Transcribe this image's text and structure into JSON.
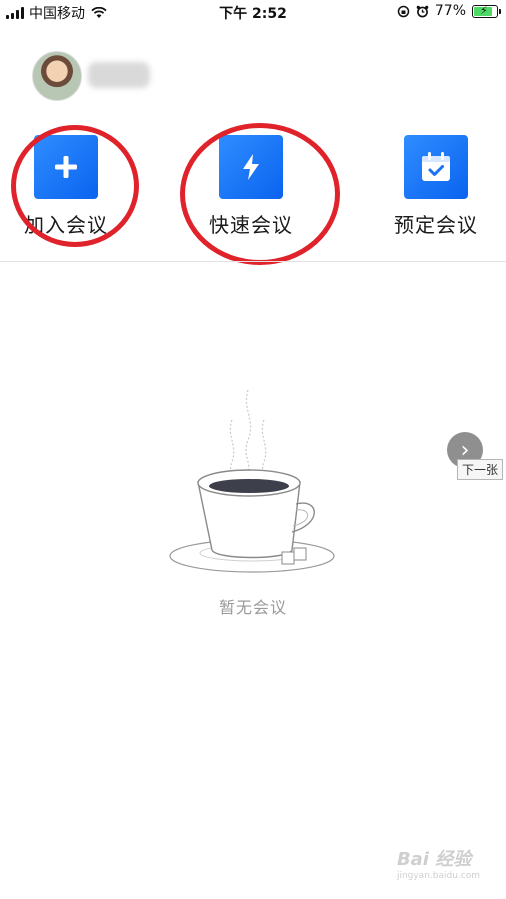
{
  "status_bar": {
    "carrier": "中国移动",
    "time": "下午 2:52",
    "battery_percent": "77%",
    "battery_level": 0.77,
    "icons": [
      "signal-icon",
      "wifi-icon",
      "rotation-lock-icon",
      "alarm-icon",
      "battery-icon"
    ]
  },
  "profile": {
    "avatar_icon": "avatar-image",
    "name_blurred": true
  },
  "actions": [
    {
      "label": "加入会议",
      "icon": "plus-icon",
      "circled": true
    },
    {
      "label": "快速会议",
      "icon": "lightning-icon",
      "circled": true
    },
    {
      "label": "预定会议",
      "icon": "calendar-check-icon",
      "circled": false
    }
  ],
  "empty_state": {
    "text": "暂无会议",
    "illustration": "coffee-cup-icon"
  },
  "pager": {
    "next_symbol": "›",
    "next_tooltip": "下一张"
  },
  "watermark": {
    "text": "Bai 经验",
    "subtext": "jingyan.baidu.com"
  },
  "colors": {
    "accent_blue": "#1a73f5",
    "annotation_red": "#e0222b",
    "muted_text": "#9a9a9a"
  }
}
